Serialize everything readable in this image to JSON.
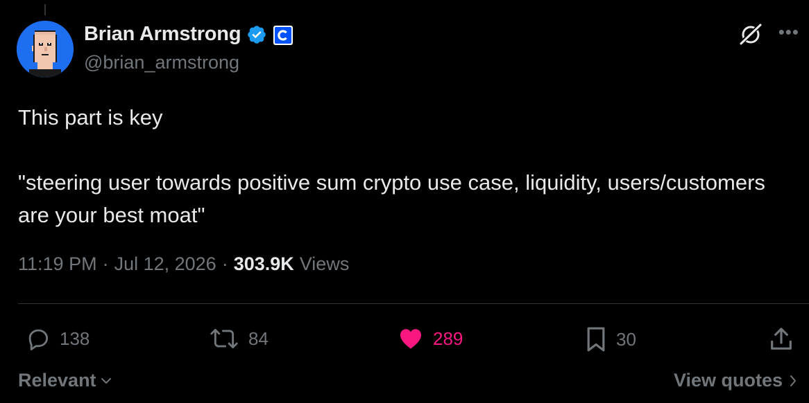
{
  "author": {
    "display_name": "Brian Armstrong",
    "handle": "@brian_armstrong",
    "avatar_icon": "pixel-punk-avatar",
    "verified_icon": "verified-badge-icon",
    "affiliation_icon": "coinbase-logo-icon"
  },
  "tweet": {
    "text": "This part is key\n\n\"steering user towards positive sum crypto use case, liquidity, users/customers are your best moat\""
  },
  "meta": {
    "time": "11:19 PM",
    "separator": "·",
    "date": "Jul 12, 2026",
    "views_count": "303.9K",
    "views_label": "Views"
  },
  "actions": {
    "replies": "138",
    "reposts": "84",
    "likes": "289",
    "bookmarks": "30"
  },
  "footer": {
    "sort_label": "Relevant",
    "quotes_label": "View quotes"
  },
  "colors": {
    "background": "#000000",
    "primary_text": "#e7e9ea",
    "secondary_text": "#71767b",
    "like_pink": "#f91880",
    "verified_blue": "#1d9bf0",
    "coinbase_blue": "#0052ff"
  }
}
